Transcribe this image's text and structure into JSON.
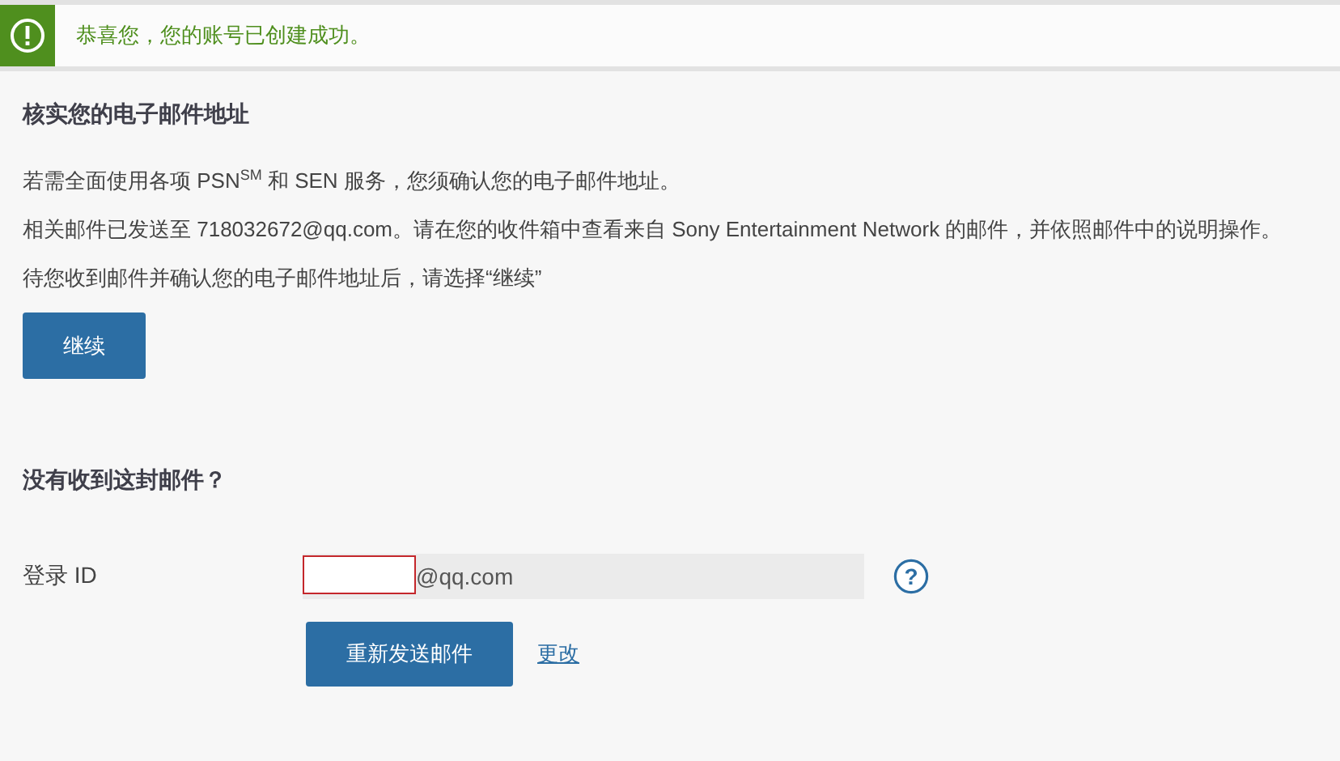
{
  "banner": {
    "message": "恭喜您，您的账号已创建成功。"
  },
  "verify": {
    "heading": "核实您的电子邮件地址",
    "paragraphs": [
      "若需全面使用各项 PSN$^{SM}$ 和 SEN 服务，您须确认您的电子邮件地址。",
      "相关邮件已发送至 718032672@qq.com。请在您的收件箱中查看来自 Sony Entertainment Network 的邮件，并依照邮件中的说明操作。",
      "待您收到邮件并确认您的电子邮件地址后，请选择“继续”"
    ],
    "button": "继续"
  },
  "resend": {
    "heading": "没有收到这封邮件？",
    "login_label": "登录 ID",
    "login_value": "@qq.com",
    "redacted": true,
    "help": "?",
    "button": "重新发送邮件",
    "change_link": "更改"
  }
}
